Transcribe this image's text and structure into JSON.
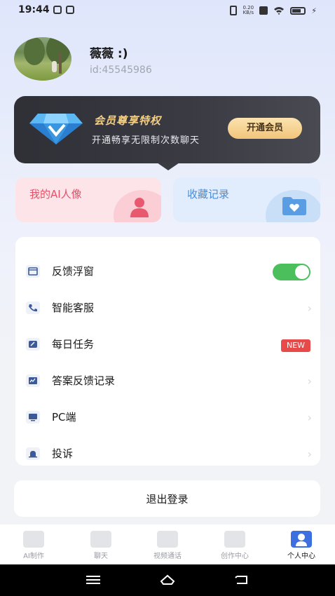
{
  "status_bar": {
    "time": "19:44",
    "net_speed": "0.20\nKB/s"
  },
  "profile": {
    "name": "薇薇 :)",
    "id": "id:45545986"
  },
  "vip": {
    "title": "会员尊享特权",
    "subtitle": "开通畅享无限制次数聊天",
    "button": "开通会员",
    "accent": "#f3cf86"
  },
  "cards": [
    {
      "label": "我的AI人像",
      "color": "#e0536a"
    },
    {
      "label": "收藏记录",
      "color": "#4a8bd6"
    }
  ],
  "menu": [
    {
      "label": "反馈浮窗",
      "icon": "window-icon",
      "control": "toggle",
      "toggle_on": true
    },
    {
      "label": "智能客服",
      "icon": "phone-icon",
      "control": "chevron"
    },
    {
      "label": "每日任务",
      "icon": "task-icon",
      "control": "badge",
      "badge": "NEW"
    },
    {
      "label": "答案反馈记录",
      "icon": "record-icon",
      "control": "chevron"
    },
    {
      "label": "PC端",
      "icon": "monitor-icon",
      "control": "chevron"
    },
    {
      "label": "投诉",
      "icon": "alarm-icon",
      "control": "chevron"
    }
  ],
  "logout": "退出登录",
  "bottom_nav": [
    {
      "label": "AI制作",
      "icon": "ai-icon",
      "active": false
    },
    {
      "label": "聊天",
      "icon": "chat-icon",
      "active": false
    },
    {
      "label": "视频通话",
      "icon": "video-icon",
      "active": false
    },
    {
      "label": "创作中心",
      "icon": "edit-icon",
      "active": false
    },
    {
      "label": "个人中心",
      "icon": "profile-icon",
      "active": true
    }
  ],
  "colors": {
    "toggle_on": "#4bbf5c",
    "badge": "#e84a4a",
    "active_tab": "#3e6fe0"
  }
}
